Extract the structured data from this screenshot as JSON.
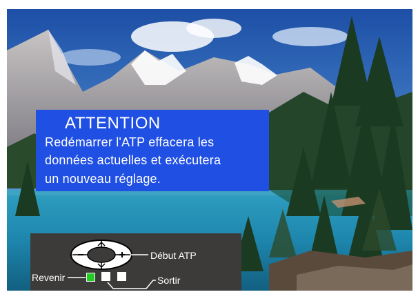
{
  "dialog": {
    "title": "ATTENTION",
    "lines": [
      "Redémarrer l'ATP effacera les",
      "données actuelles et exécutera",
      "un nouveau réglage."
    ]
  },
  "legend": {
    "start_atp": "Début ATP",
    "back": "Revenir",
    "exit": "Sortir"
  },
  "icons": {
    "minus": "minus-icon",
    "plus": "plus-icon",
    "up": "up-arrow-icon",
    "down": "down-arrow-icon",
    "back_button": "green-square-button",
    "exit_buttons": "white-square-button"
  },
  "colors": {
    "dialog_bg": "#1f4fe3",
    "panel_bg": "#3d3b3a",
    "back_button": "#22cc22"
  }
}
